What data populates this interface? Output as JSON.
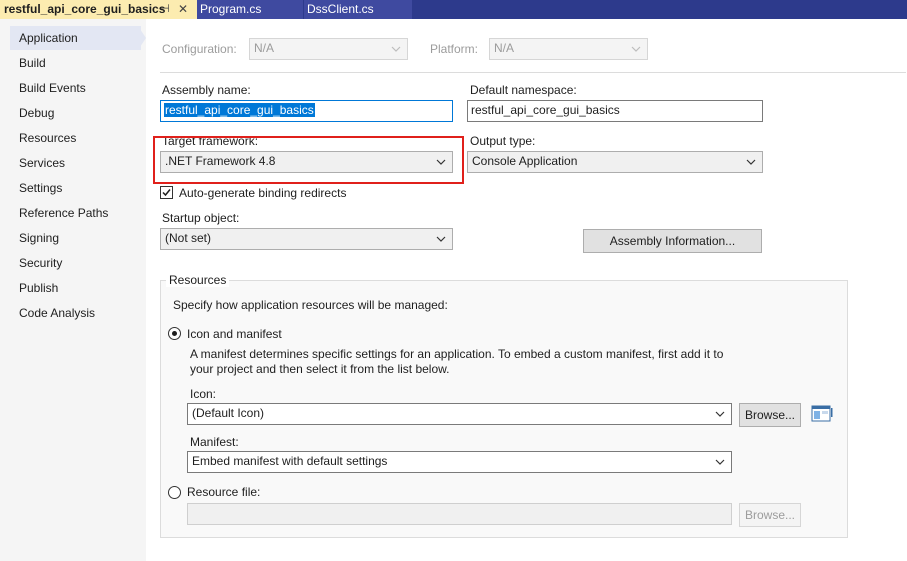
{
  "tabs": {
    "active": "restful_api_core_gui_basics",
    "items": [
      "Program.cs",
      "DssClient.cs"
    ],
    "pin_glyph": "⊣",
    "close_glyph": "✕"
  },
  "nav": {
    "items": [
      "Application",
      "Build",
      "Build Events",
      "Debug",
      "Resources",
      "Services",
      "Settings",
      "Reference Paths",
      "Signing",
      "Security",
      "Publish",
      "Code Analysis"
    ],
    "selected": "Application"
  },
  "config": {
    "configuration_label": "Configuration:",
    "configuration_value": "N/A",
    "platform_label": "Platform:",
    "platform_value": "N/A"
  },
  "app": {
    "assembly_name_label": "Assembly name:",
    "assembly_name_value": "restful_api_core_gui_basics",
    "default_namespace_label": "Default namespace:",
    "default_namespace_value": "restful_api_core_gui_basics",
    "target_framework_label": "Target framework:",
    "target_framework_value": ".NET Framework 4.8",
    "output_type_label": "Output type:",
    "output_type_value": "Console Application",
    "auto_binding_label": "Auto-generate binding redirects",
    "auto_binding_checked": true,
    "startup_object_label": "Startup object:",
    "startup_object_value": "(Not set)",
    "assembly_info_button": "Assembly Information..."
  },
  "resources": {
    "group_label": "Resources",
    "description": "Specify how application resources will be managed:",
    "icon_manifest_option": "Icon and manifest",
    "icon_manifest_desc_line1": "A manifest determines specific settings for an application. To embed a custom manifest, first add it to",
    "icon_manifest_desc_line2": "your project and then select it from the list below.",
    "icon_label": "Icon:",
    "icon_value": "(Default Icon)",
    "browse_label": "Browse...",
    "manifest_label": "Manifest:",
    "manifest_value": "Embed manifest with default settings",
    "resource_file_option": "Resource file:",
    "resource_file_value": "",
    "resource_browse_label": "Browse...",
    "selected_option": "icon_and_manifest"
  },
  "colors": {
    "accent": "#0078d7",
    "highlight": "#e0201b",
    "tab_active": "#fcecb0",
    "tab_strip": "#2d3a8c"
  }
}
